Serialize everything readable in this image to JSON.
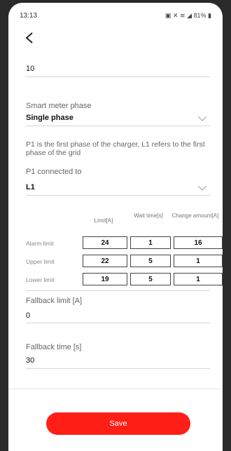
{
  "status_bar": {
    "time": "13:13",
    "battery": "81%",
    "icons": [
      "alarm-icon",
      "mute-icon",
      "wifi-icon",
      "signal-icon",
      "battery-icon"
    ]
  },
  "top_value": "10",
  "smart_meter_phase": {
    "label": "Smart meter phase",
    "value": "Single phase"
  },
  "info_text": "P1 is the first phase of the charger, L1 refers to the first phase of the grid",
  "p1_connected": {
    "label": "P1 connected to",
    "value": "L1"
  },
  "limits_table": {
    "headers": [
      "Limit[A]",
      "Wait time[s]",
      "Change amount[A]"
    ],
    "rows": [
      {
        "label": "Alarm limit",
        "values": [
          "24",
          "1",
          "16"
        ]
      },
      {
        "label": "Upper limit",
        "values": [
          "22",
          "5",
          "1"
        ]
      },
      {
        "label": "Lower limit",
        "values": [
          "19",
          "5",
          "1"
        ]
      }
    ]
  },
  "fallback_limit": {
    "label": "Fallback limit [A]",
    "value": "0"
  },
  "fallback_time": {
    "label": "Fallback time [s]",
    "value": "30"
  },
  "save_button": {
    "label": "Save"
  },
  "colors": {
    "accent": "#ff1f17",
    "background": "#ffffff"
  }
}
